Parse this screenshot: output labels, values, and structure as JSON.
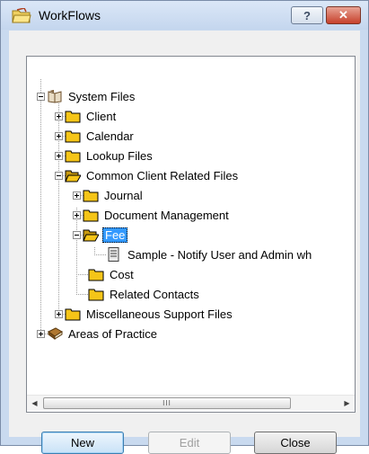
{
  "window": {
    "title": "WorkFlows",
    "help_label": "?",
    "close_label": "✕"
  },
  "tree": {
    "nodes": [
      {
        "label": "System Files",
        "expander": "minus",
        "icon": "book-icon"
      },
      {
        "label": "Client",
        "expander": "plus",
        "icon": "folder-icon"
      },
      {
        "label": "Calendar",
        "expander": "plus",
        "icon": "folder-icon"
      },
      {
        "label": "Lookup Files",
        "expander": "plus",
        "icon": "folder-icon"
      },
      {
        "label": "Common Client Related Files",
        "expander": "minus",
        "icon": "open-folder-icon"
      },
      {
        "label": "Journal",
        "expander": "plus",
        "icon": "folder-icon"
      },
      {
        "label": "Document Management",
        "expander": "plus",
        "icon": "folder-icon"
      },
      {
        "label": "Fee",
        "expander": "minus",
        "icon": "open-folder-icon",
        "selected": true
      },
      {
        "label": "Sample - Notify User and Admin wh",
        "expander": "none",
        "icon": "document-icon"
      },
      {
        "label": "Cost",
        "expander": "none",
        "icon": "folder-icon"
      },
      {
        "label": "Related Contacts",
        "expander": "none",
        "icon": "folder-icon"
      },
      {
        "label": "Miscellaneous Support Files",
        "expander": "plus",
        "icon": "folder-icon"
      },
      {
        "label": "Areas of Practice",
        "expander": "plus",
        "icon": "closed-book-icon"
      }
    ]
  },
  "scrollbar": {
    "left_arrow": "◀",
    "right_arrow": "▶",
    "grip": "III"
  },
  "buttons": {
    "new_label": "New",
    "edit_label": "Edit",
    "close_label": "Close"
  },
  "colors": {
    "selection": "#3399ff",
    "folder": "#f5c518",
    "title_gradient_top": "#dbe7f7",
    "title_gradient_bottom": "#c4d6ee",
    "close_button": "#c6402b"
  }
}
